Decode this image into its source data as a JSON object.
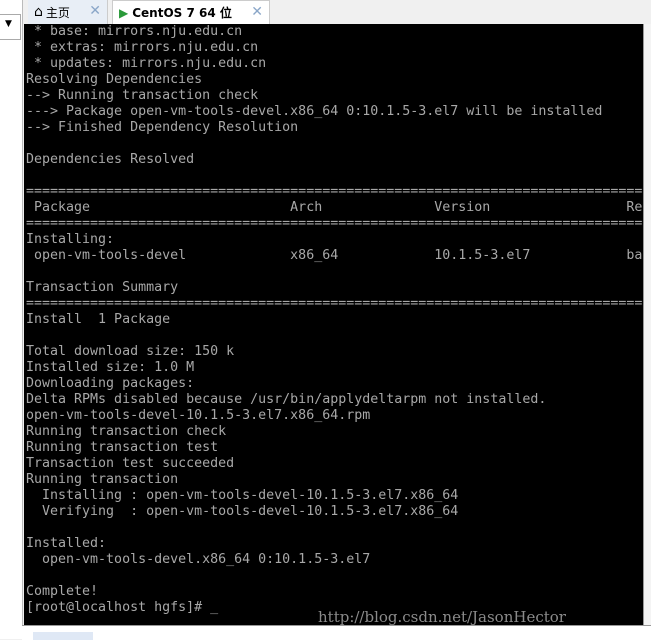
{
  "tabs": [
    {
      "label": "主页",
      "icon": "home-icon"
    },
    {
      "label": "CentOS 7 64 位",
      "icon": "vm-icon"
    }
  ],
  "terminal_lines": [
    " * base: mirrors.nju.edu.cn",
    " * extras: mirrors.nju.edu.cn",
    " * updates: mirrors.nju.edu.cn",
    "Resolving Dependencies",
    "--> Running transaction check",
    "---> Package open-vm-tools-devel.x86_64 0:10.1.5-3.el7 will be installed",
    "--> Finished Dependency Resolution",
    "",
    "Dependencies Resolved",
    "",
    "==============================================================================",
    " Package                         Arch              Version                 Re",
    "==============================================================================",
    "Installing:",
    " open-vm-tools-devel             x86_64            10.1.5-3.el7            ba",
    "",
    "Transaction Summary",
    "==============================================================================",
    "Install  1 Package",
    "",
    "Total download size: 150 k",
    "Installed size: 1.0 M",
    "Downloading packages:",
    "Delta RPMs disabled because /usr/bin/applydeltarpm not installed.",
    "open-vm-tools-devel-10.1.5-3.el7.x86_64.rpm",
    "Running transaction check",
    "Running transaction test",
    "Transaction test succeeded",
    "Running transaction",
    "  Installing : open-vm-tools-devel-10.1.5-3.el7.x86_64",
    "  Verifying  : open-vm-tools-devel-10.1.5-3.el7.x86_64",
    "",
    "Installed:",
    "  open-vm-tools-devel.x86_64 0:10.1.5-3.el7",
    "",
    "Complete!",
    "[root@localhost hgfs]# _"
  ],
  "watermark": "http://blog.csdn.net/JasonHector",
  "colors": {
    "terminal_bg": "#000000",
    "terminal_fg": "#a8a8a8"
  }
}
